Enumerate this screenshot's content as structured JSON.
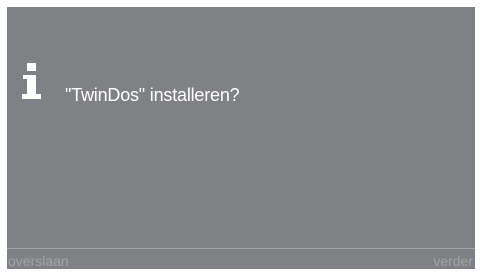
{
  "dialog": {
    "icon": "info-icon",
    "message": "\"TwinDos\" installeren?"
  },
  "softkeys": {
    "left_label": "overslaan",
    "right_label": "verder"
  },
  "colors": {
    "screen_background": "#808184",
    "text_primary": "#ffffff",
    "text_softkey": "#a3a4a7"
  }
}
